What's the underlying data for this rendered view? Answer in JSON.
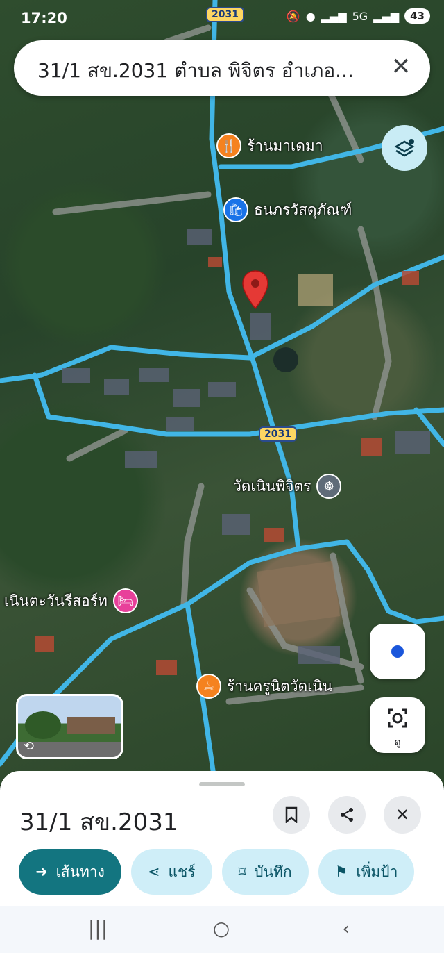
{
  "status_bar": {
    "time": "17:20",
    "network": "5G",
    "battery": "43"
  },
  "search": {
    "query": "31/1 สข.2031 ตำบล พิจิตร อำเภอ..."
  },
  "map": {
    "route_badges": [
      "2031",
      "2031"
    ],
    "pois": [
      {
        "name": "ร้านมาเดมา",
        "icon": "restaurant-icon",
        "color": "#f5821f"
      },
      {
        "name": "ธนภรวัสดุภัณฑ์",
        "icon": "shopping-bag-icon",
        "color": "#1a73e8"
      },
      {
        "name": "วัดเนินพิจิตร",
        "icon": "dharma-wheel-icon",
        "color": "#5f6b78"
      },
      {
        "name": "เนินตะวันรีสอร์ท",
        "icon": "hotel-icon",
        "color": "#e8409a"
      },
      {
        "name": "ร้านครูนิตวัดเนิน",
        "icon": "cafe-icon",
        "color": "#f5821f"
      }
    ],
    "lens_label": "ดู",
    "accent_route": "#41b6e6",
    "pin_color": "#e53935"
  },
  "sheet": {
    "title": "31/1 สข.2031",
    "actions": [
      {
        "label": "เส้นทาง",
        "icon": "directions-icon"
      },
      {
        "label": "แชร์",
        "icon": "share-icon"
      },
      {
        "label": "บันทึก",
        "icon": "bookmark-icon"
      },
      {
        "label": "เพิ่มป้า",
        "icon": "flag-icon"
      }
    ]
  }
}
